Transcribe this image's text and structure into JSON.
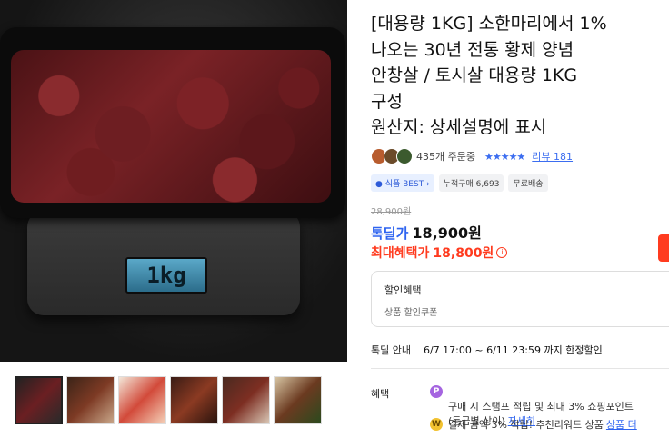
{
  "product": {
    "title": "[대용량 1KG] 소한마리에서 1%\n나오는 30년 전통 황제 양념\n안창살 / 토시살 대용량 1KG\n구성\n원산지: 상세설명에 표시",
    "scale_reading": "1kg"
  },
  "rating": {
    "order_count": "435개 주문중",
    "stars": "★★★★★",
    "review_label": "리뷰 181"
  },
  "badges": {
    "best": "● 식품 BEST ›",
    "cumulative": "누적구매 6,693",
    "shipping": "무료배송"
  },
  "price": {
    "original": "28,900원",
    "deal_label": "톡딜가",
    "deal_price": "18,900원",
    "max_label": "최대혜택가",
    "max_price": "18,800원",
    "info_icon": "i"
  },
  "coupon_box": {
    "title": "할인혜택",
    "subtitle": "상품 할인쿠폰"
  },
  "deal_info": {
    "label": "톡딜 안내",
    "value": "6/7 17:00 ~ 6/11 23:59 까지 한정할인"
  },
  "benefits": {
    "label": "혜택",
    "items": [
      {
        "icon": "P",
        "text": "구매 시 스탬프 적립 및 최대 3% 쇼핑포인트\n(등급별 상이)",
        "link": "자세히"
      },
      {
        "icon": "W",
        "text": "결제 금액 3% 적립! 추천리워드 상품",
        "link": "상품 더"
      }
    ]
  },
  "colors": {
    "deal_blue": "#2e64f0",
    "max_red": "#ff3b1f",
    "star_blue": "#3b6df0"
  }
}
